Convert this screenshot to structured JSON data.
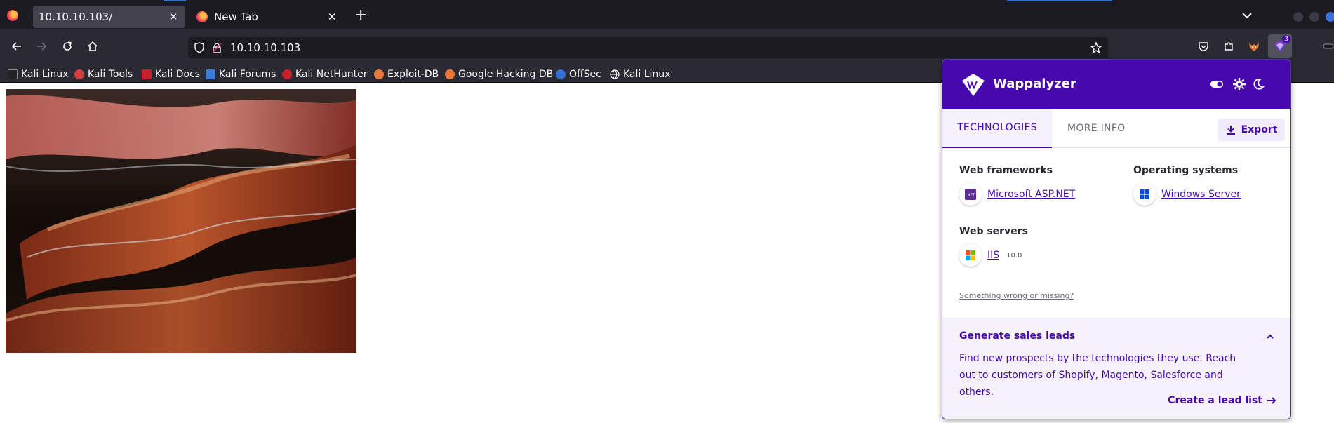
{
  "browser": {
    "tabs": [
      {
        "title": "10.10.10.103/",
        "active": true
      },
      {
        "title": "New Tab",
        "active": false
      }
    ],
    "url": "10.10.10.103",
    "extension_badge": "3"
  },
  "bookmarks": [
    {
      "label": "Kali Linux",
      "icon": "kali-icon"
    },
    {
      "label": "Kali Tools",
      "icon": "kali-tools-icon"
    },
    {
      "label": "Kali Docs",
      "icon": "kali-docs-icon"
    },
    {
      "label": "Kali Forums",
      "icon": "kali-forums-icon"
    },
    {
      "label": "Kali NetHunter",
      "icon": "nethunter-icon"
    },
    {
      "label": "Exploit-DB",
      "icon": "exploitdb-icon"
    },
    {
      "label": "Google Hacking DB",
      "icon": "ghdb-icon"
    },
    {
      "label": "OffSec",
      "icon": "offsec-icon"
    },
    {
      "label": "Kali Linux",
      "icon": "globe-icon"
    }
  ],
  "wappalyzer": {
    "brand": "Wappalyzer",
    "tabs": {
      "technologies": "TECHNOLOGIES",
      "more_info": "MORE INFO"
    },
    "export_label": "Export",
    "categories": [
      {
        "title": "Web frameworks",
        "items": [
          {
            "name": "Microsoft ASP.NET",
            "version": ""
          }
        ]
      },
      {
        "title": "Operating systems",
        "items": [
          {
            "name": "Windows Server",
            "version": ""
          }
        ]
      },
      {
        "title": "Web servers",
        "items": [
          {
            "name": "IIS",
            "version": "10.0"
          }
        ]
      }
    ],
    "wrong_link": "Something wrong or missing?",
    "leads": {
      "title": "Generate sales leads",
      "text": "Find new prospects by the technologies they use. Reach out to customers of Shopify, Magento, Salesforce and others.",
      "cta": "Create a lead list"
    }
  },
  "colors": {
    "brand": "#4608ad",
    "tabstrip": "#1c1b22",
    "toolbar": "#2b2a33"
  }
}
